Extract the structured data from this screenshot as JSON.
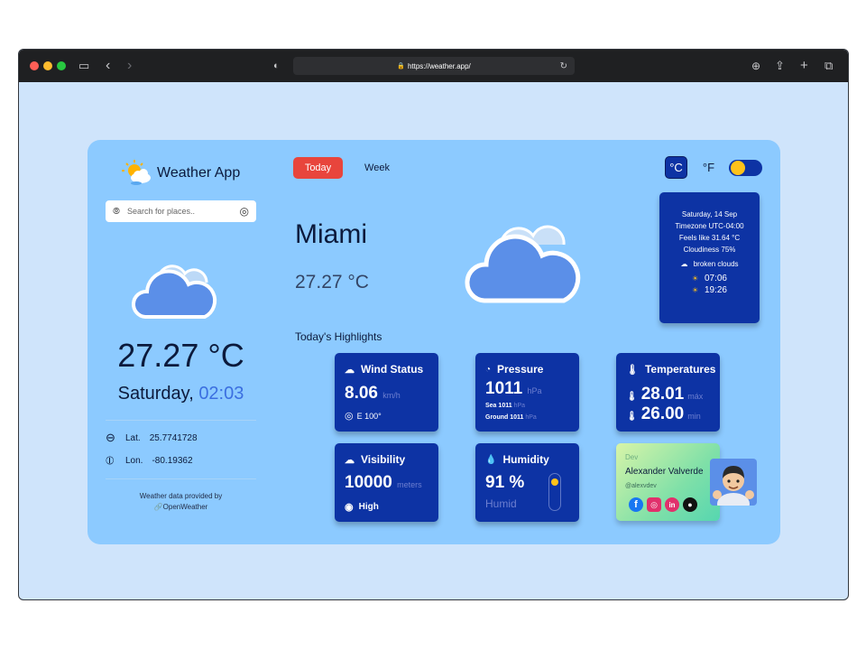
{
  "browser": {
    "url": "https://weather.app/",
    "colors": {
      "close": "#ff5f57",
      "minimize": "#febc2e",
      "zoom": "#28c840"
    }
  },
  "app": {
    "title": "Weather App",
    "search_placeholder": "Search for places..",
    "current": {
      "temperature": "27.27 °C",
      "day": "Saturday,",
      "time": "02:03"
    },
    "coords": {
      "lat_label": "Lat.",
      "lat_value": "25.7741728",
      "lon_label": "Lon.",
      "lon_value": "-80.19362"
    },
    "attribution": {
      "line1": "Weather data provided by",
      "line2": "OpenWeather"
    }
  },
  "tabs": {
    "today": "Today",
    "week": "Week"
  },
  "units": {
    "celsius": "°C",
    "fahrenheit": "°F"
  },
  "main": {
    "city": "Miami",
    "temperature": "27.27 °C",
    "highlights_title": "Today's Highlights"
  },
  "info_box": {
    "date": "Saturday, 14 Sep",
    "timezone": "Timezone UTC-04:00",
    "feels_like": "Feels like 31.64 °C",
    "cloudiness": "Cloudiness 75%",
    "condition": "broken clouds",
    "sunrise": "07:06",
    "sunset": "19:26"
  },
  "highlights": {
    "wind": {
      "title": "Wind Status",
      "value": "8.06",
      "unit": "km/h",
      "direction": "E 100°"
    },
    "pressure": {
      "title": "Pressure",
      "value": "1011",
      "unit": "hPa",
      "sea_label": "Sea",
      "sea_value": "1011",
      "sea_unit": "hPa",
      "ground_label": "Ground",
      "ground_value": "1011",
      "ground_unit": "hPa"
    },
    "temperatures": {
      "title": "Temperatures",
      "max_value": "28.01",
      "max_label": "máx",
      "min_value": "26.00",
      "min_label": "min"
    },
    "visibility": {
      "title": "Visibility",
      "value": "10000",
      "unit": "meters",
      "level": "High"
    },
    "humidity": {
      "title": "Humidity",
      "value": "91 %",
      "label": "Humid",
      "level": 0.91
    }
  },
  "dev": {
    "label": "Dev",
    "name": "Alexander Valverde",
    "handle": "@alexvdev"
  }
}
